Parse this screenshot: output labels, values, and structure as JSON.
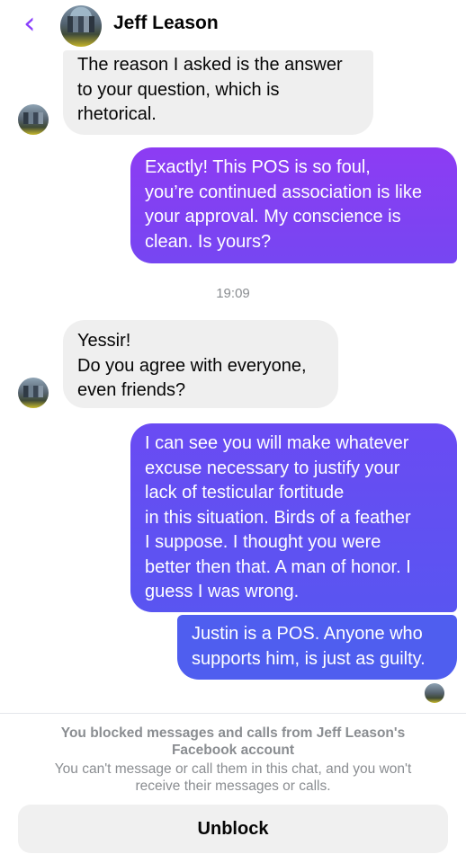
{
  "header": {
    "back_icon": "‹",
    "contact_name": "Jeff Leason"
  },
  "messages": [
    {
      "direction": "in",
      "text": "The reason I asked is the answer\nto your question, which is\nrhetorical."
    },
    {
      "direction": "out",
      "text": "Exactly!  This POS is so foul,\nyou’re continued association is like\nyour approval.  My conscience is\nclean.  Is yours?"
    },
    {
      "direction": "in",
      "text": "Yessir!\nDo you agree with everyone,\neven friends?"
    },
    {
      "direction": "out",
      "text": "I can see you will make whatever\nexcuse necessary to justify your\nlack of testicular fortitude\nin this situation.  Birds of a feather\nI suppose.  I thought you were\nbetter then that.  A man of honor.  I\nguess I was wrong."
    },
    {
      "direction": "out",
      "text": "Justin is a POS.  Anyone who\nsupports him, is just as guilty."
    }
  ],
  "timestamp": "19:09",
  "blocked_notice": {
    "title": "You blocked messages and calls from Jeff Leason's\nFacebook account",
    "subtitle": "You can't message or call them in this chat, and you won't\nreceive their messages or calls."
  },
  "unblock_label": "Unblock",
  "colors": {
    "accent": "#8a3ffc",
    "outgoing_top": "#8b3ef2",
    "outgoing_bottom": "#4f5ff0",
    "incoming": "#efefef"
  }
}
